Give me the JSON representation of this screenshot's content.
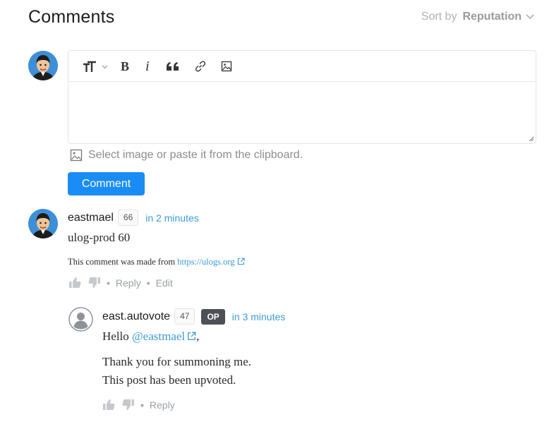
{
  "header": {
    "title": "Comments",
    "sort_label": "Sort by",
    "sort_value": "Reputation"
  },
  "composer": {
    "placeholder": "",
    "upload_hint": "Select image or paste it from the clipboard.",
    "submit_label": "Comment",
    "toolbar": [
      "text-size-icon",
      "bold-icon",
      "italic-icon",
      "quote-icon",
      "link-icon",
      "image-icon"
    ]
  },
  "comments": [
    {
      "author": "eastmael",
      "reputation": "66",
      "time": "in 2 minutes",
      "body": "ulog-prod 60",
      "source_prefix": "This comment was made from",
      "source_link": "https://ulogs.org",
      "actions": {
        "reply": "Reply",
        "edit": "Edit"
      }
    },
    {
      "author": "east.autovote",
      "reputation": "47",
      "badge": "OP",
      "time": "in 3 minutes",
      "body_greeting": "Hello",
      "body_mention": "@eastmael",
      "body_after_mention": ",",
      "body_line2": "Thank you for summoning me.",
      "body_line3": "This post has been upvoted.",
      "actions": {
        "reply": "Reply"
      }
    }
  ],
  "colors": {
    "accent": "#1a8cf5",
    "link": "#3b9ad9",
    "muted": "#9aa0a6"
  }
}
